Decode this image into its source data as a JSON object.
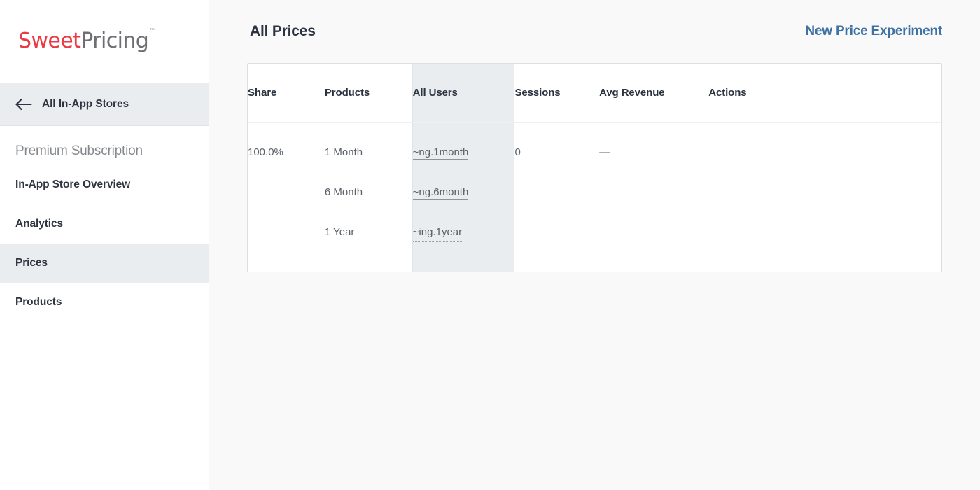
{
  "brand": {
    "name_part1": "Sweet",
    "name_part2": "Pricing",
    "trademark": "™",
    "color_primary": "#ea3b45",
    "color_secondary": "#6e6f73"
  },
  "sidebar": {
    "back": {
      "icon": "arrow-left-icon",
      "label": "All In-App Stores"
    },
    "section_label": "Premium Subscription",
    "items": [
      {
        "label": "In-App Store Overview",
        "active": false
      },
      {
        "label": "Analytics",
        "active": false
      },
      {
        "label": "Prices",
        "active": true
      },
      {
        "label": "Products",
        "active": false
      }
    ]
  },
  "header": {
    "title": "All Prices",
    "action_label": "New Price Experiment",
    "action_color": "#3f72a4"
  },
  "table": {
    "highlight_color": "#e9edf0",
    "columns": [
      {
        "key": "share",
        "label": "Share",
        "highlighted": false
      },
      {
        "key": "products",
        "label": "Products",
        "highlighted": false
      },
      {
        "key": "users",
        "label": "All Users",
        "highlighted": true
      },
      {
        "key": "sessions",
        "label": "Sessions",
        "highlighted": false
      },
      {
        "key": "revenue",
        "label": "Avg Revenue",
        "highlighted": false
      },
      {
        "key": "actions",
        "label": "Actions",
        "highlighted": false
      }
    ],
    "rows": [
      {
        "share": "100.0%",
        "products": [
          "1 Month",
          "6 Month",
          "1 Year"
        ],
        "users": [
          "~ng.1month",
          "~ng.6month",
          "~ing.1year"
        ],
        "sessions": "0",
        "revenue": "—",
        "actions": ""
      }
    ]
  }
}
